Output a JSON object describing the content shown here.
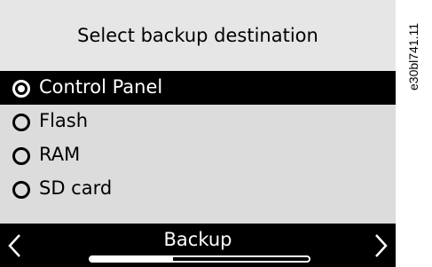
{
  "header": {
    "title": "Select backup destination"
  },
  "options": [
    {
      "label": "Control Panel",
      "selected": true
    },
    {
      "label": "Flash",
      "selected": false
    },
    {
      "label": "RAM",
      "selected": false
    },
    {
      "label": "SD card",
      "selected": false
    }
  ],
  "footer": {
    "title": "Backup",
    "left_icon": "chevron-left-icon",
    "right_icon": "chevron-right-icon",
    "progress_fraction": 0.38
  },
  "side_code": "e30bl741.11",
  "colors": {
    "screen_background": "#dcdcdc",
    "header_background": "#e6e6e6",
    "selected_background": "#000000",
    "footer_background": "#000000"
  }
}
